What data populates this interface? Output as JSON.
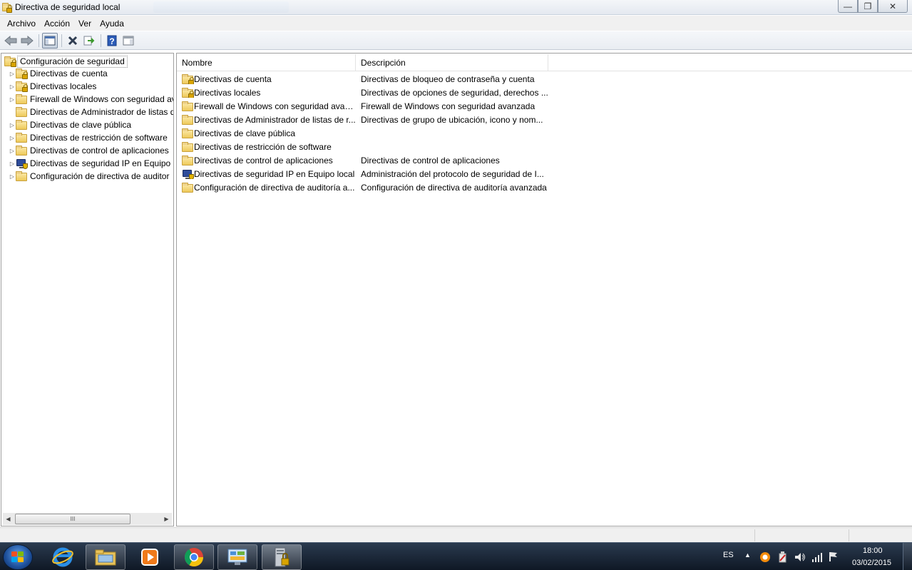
{
  "window": {
    "title": "Directiva de seguridad local",
    "buttons": {
      "minimize": "—",
      "maximize": "❐",
      "close": "✕"
    }
  },
  "menubar": [
    "Archivo",
    "Acción",
    "Ver",
    "Ayuda"
  ],
  "toolbar": {
    "icons": [
      "back-arrow-icon",
      "forward-arrow-icon",
      "show-hide-tree-icon",
      "delete-icon",
      "export-list-icon",
      "help-icon",
      "show-hide-action-pane-icon"
    ]
  },
  "tree": {
    "root": "Configuración de seguridad",
    "items": [
      {
        "label": "Directivas de cuenta",
        "icon": "folder-lock",
        "expandable": true
      },
      {
        "label": "Directivas locales",
        "icon": "folder-lock",
        "expandable": true
      },
      {
        "label": "Firewall de Windows con seguridad av",
        "icon": "folder",
        "expandable": true
      },
      {
        "label": "Directivas de Administrador de listas d",
        "icon": "folder",
        "expandable": false
      },
      {
        "label": "Directivas de clave pública",
        "icon": "folder",
        "expandable": true
      },
      {
        "label": "Directivas de restricción de software",
        "icon": "folder",
        "expandable": true
      },
      {
        "label": "Directivas de control de aplicaciones",
        "icon": "folder",
        "expandable": true
      },
      {
        "label": "Directivas de seguridad IP en Equipo l",
        "icon": "ip-security",
        "expandable": true
      },
      {
        "label": "Configuración de directiva de auditor",
        "icon": "folder",
        "expandable": true
      }
    ],
    "scrollbar_thumb": "III"
  },
  "list": {
    "columns": [
      "Nombre",
      "Descripción"
    ],
    "rows": [
      {
        "name": "Directivas de cuenta",
        "desc": "Directivas de bloqueo de contraseña y cuenta",
        "icon": "folder-lock"
      },
      {
        "name": "Directivas locales",
        "desc": "Directivas de opciones de seguridad, derechos ...",
        "icon": "folder-lock"
      },
      {
        "name": "Firewall de Windows con seguridad avan...",
        "desc": "Firewall de Windows con seguridad avanzada",
        "icon": "folder"
      },
      {
        "name": "Directivas de Administrador de listas de r...",
        "desc": "Directivas de grupo de ubicación, icono y nom...",
        "icon": "folder"
      },
      {
        "name": "Directivas de clave pública",
        "desc": "",
        "icon": "folder"
      },
      {
        "name": "Directivas de restricción de software",
        "desc": "",
        "icon": "folder"
      },
      {
        "name": "Directivas de control de aplicaciones",
        "desc": "Directivas de control de aplicaciones",
        "icon": "folder"
      },
      {
        "name": "Directivas de seguridad IP en Equipo local",
        "desc": "Administración del protocolo de seguridad de I...",
        "icon": "ip-security"
      },
      {
        "name": "Configuración de directiva de auditoría a...",
        "desc": "Configuración de directiva de auditoría avanzada",
        "icon": "folder"
      }
    ]
  },
  "taskbar": {
    "apps": [
      "internet-explorer-icon",
      "file-explorer-icon",
      "media-player-icon",
      "chrome-icon",
      "control-panel-icon",
      "local-security-policy-icon"
    ],
    "tray": {
      "language": "ES",
      "time": "18:00",
      "date": "03/02/2015"
    }
  },
  "colors": {
    "taskbar": "#16212f",
    "accent": "#3b78c8",
    "folder": "#eec95a"
  }
}
